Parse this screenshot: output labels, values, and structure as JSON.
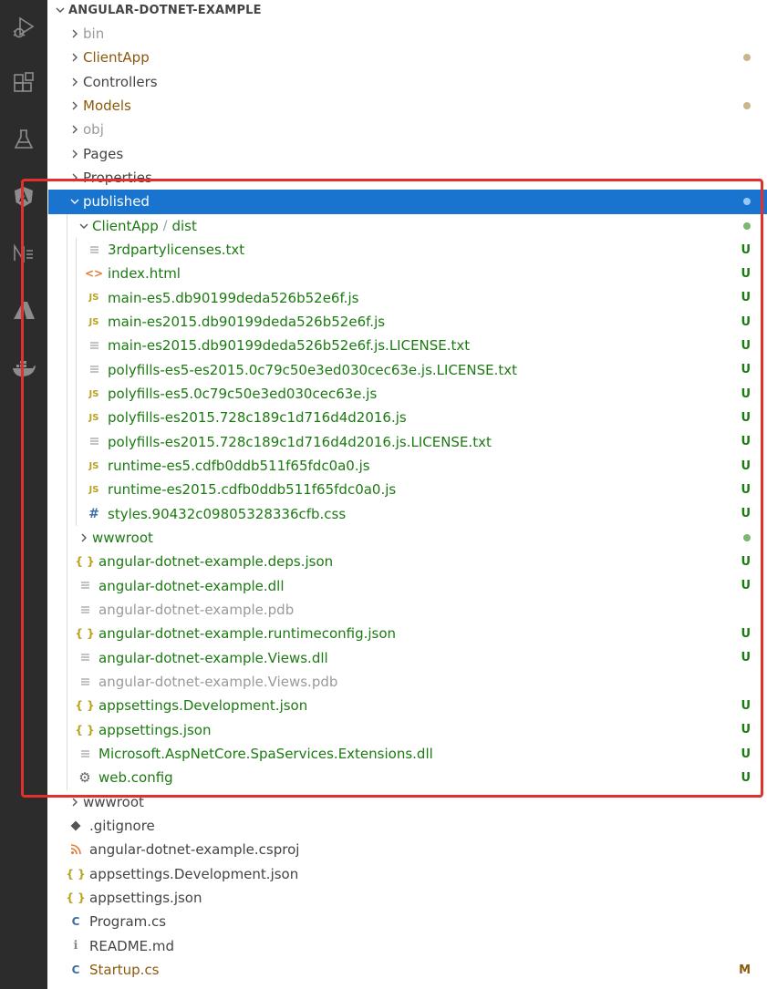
{
  "colors": {
    "activity_bar_bg": "#2c2c2c",
    "activity_icon": "#8c8c8c",
    "selected_bg": "#1874cf",
    "untracked_green": "#1c7a12",
    "modified_brown": "#8d5a0c",
    "ignored_gray": "#9a9a9a",
    "dot_tan": "#c9b68c",
    "dot_green": "#7ab86e",
    "dot_blue": "#9ac8f5",
    "highlight_red": "#e0322a",
    "js_icon": "#b9a21d",
    "json_icon": "#b9a21d",
    "html_icon": "#e37933",
    "css_icon": "#3c6fa8",
    "csproj_icon": "#e37933",
    "cs_icon": "#3c6fa8",
    "git_icon": "#555555"
  },
  "activity_bar": {
    "icons": [
      "run-debug-icon",
      "extensions-icon",
      "testing-icon",
      "angular-icon",
      "nuget-icon",
      "azure-icon",
      "docker-icon"
    ]
  },
  "explorer": {
    "root": {
      "label": "ANGULAR-DOTNET-EXAMPLE"
    },
    "items": [
      {
        "label": "bin",
        "kind": "folder",
        "depth": 1,
        "expanded": false,
        "color": "muted"
      },
      {
        "label": "ClientApp",
        "kind": "folder",
        "depth": 1,
        "expanded": false,
        "color": "mod",
        "badge": "dot-tan"
      },
      {
        "label": "Controllers",
        "kind": "folder",
        "depth": 1,
        "expanded": false,
        "color": "norm"
      },
      {
        "label": "Models",
        "kind": "folder",
        "depth": 1,
        "expanded": false,
        "color": "mod",
        "badge": "dot-tan"
      },
      {
        "label": "obj",
        "kind": "folder",
        "depth": 1,
        "expanded": false,
        "color": "muted"
      },
      {
        "label": "Pages",
        "kind": "folder",
        "depth": 1,
        "expanded": false,
        "color": "norm"
      },
      {
        "label": "Properties",
        "kind": "folder",
        "depth": 1,
        "expanded": false,
        "color": "norm"
      },
      {
        "label": "published",
        "kind": "folder",
        "depth": 1,
        "expanded": true,
        "color": "green",
        "badge": "dot-blue",
        "selected": true
      },
      {
        "label": "ClientApp",
        "label2": "dist",
        "kind": "folder",
        "depth": 2,
        "expanded": true,
        "color": "green",
        "badge": "dot-green"
      },
      {
        "label": "3rdpartylicenses.txt",
        "kind": "txt",
        "depth": 3,
        "color": "green",
        "badge": "U"
      },
      {
        "label": "index.html",
        "kind": "html",
        "depth": 3,
        "color": "green",
        "badge": "U"
      },
      {
        "label": "main-es5.db90199deda526b52e6f.js",
        "kind": "js",
        "depth": 3,
        "color": "green",
        "badge": "U"
      },
      {
        "label": "main-es2015.db90199deda526b52e6f.js",
        "kind": "js",
        "depth": 3,
        "color": "green",
        "badge": "U"
      },
      {
        "label": "main-es2015.db90199deda526b52e6f.js.LICENSE.txt",
        "kind": "txt",
        "depth": 3,
        "color": "green",
        "badge": "U"
      },
      {
        "label": "polyfills-es5-es2015.0c79c50e3ed030cec63e.js.LICENSE.txt",
        "kind": "txt",
        "depth": 3,
        "color": "green",
        "badge": "U"
      },
      {
        "label": "polyfills-es5.0c79c50e3ed030cec63e.js",
        "kind": "js",
        "depth": 3,
        "color": "green",
        "badge": "U"
      },
      {
        "label": "polyfills-es2015.728c189c1d716d4d2016.js",
        "kind": "js",
        "depth": 3,
        "color": "green",
        "badge": "U"
      },
      {
        "label": "polyfills-es2015.728c189c1d716d4d2016.js.LICENSE.txt",
        "kind": "txt",
        "depth": 3,
        "color": "green",
        "badge": "U"
      },
      {
        "label": "runtime-es5.cdfb0ddb511f65fdc0a0.js",
        "kind": "js",
        "depth": 3,
        "color": "green",
        "badge": "U"
      },
      {
        "label": "runtime-es2015.cdfb0ddb511f65fdc0a0.js",
        "kind": "js",
        "depth": 3,
        "color": "green",
        "badge": "U"
      },
      {
        "label": "styles.90432c09805328336cfb.css",
        "kind": "css",
        "depth": 3,
        "color": "green",
        "badge": "U"
      },
      {
        "label": "wwwroot",
        "kind": "folder",
        "depth": 2,
        "expanded": false,
        "color": "green",
        "badge": "dot-green"
      },
      {
        "label": "angular-dotnet-example.deps.json",
        "kind": "json",
        "depth": 2,
        "color": "green",
        "badge": "U"
      },
      {
        "label": "angular-dotnet-example.dll",
        "kind": "txt",
        "depth": 2,
        "color": "green",
        "badge": "U"
      },
      {
        "label": "angular-dotnet-example.pdb",
        "kind": "txt",
        "depth": 2,
        "color": "muted"
      },
      {
        "label": "angular-dotnet-example.runtimeconfig.json",
        "kind": "json",
        "depth": 2,
        "color": "green",
        "badge": "U"
      },
      {
        "label": "angular-dotnet-example.Views.dll",
        "kind": "txt",
        "depth": 2,
        "color": "green",
        "badge": "U"
      },
      {
        "label": "angular-dotnet-example.Views.pdb",
        "kind": "txt",
        "depth": 2,
        "color": "muted"
      },
      {
        "label": "appsettings.Development.json",
        "kind": "json",
        "depth": 2,
        "color": "green",
        "badge": "U"
      },
      {
        "label": "appsettings.json",
        "kind": "json",
        "depth": 2,
        "color": "green",
        "badge": "U"
      },
      {
        "label": "Microsoft.AspNetCore.SpaServices.Extensions.dll",
        "kind": "txt",
        "depth": 2,
        "color": "green",
        "badge": "U"
      },
      {
        "label": "web.config",
        "kind": "config",
        "depth": 2,
        "color": "green",
        "badge": "U"
      },
      {
        "label": "wwwroot",
        "kind": "folder",
        "depth": 1,
        "expanded": false,
        "color": "norm"
      },
      {
        "label": ".gitignore",
        "kind": "git",
        "depth": 1,
        "color": "norm"
      },
      {
        "label": "angular-dotnet-example.csproj",
        "kind": "csproj",
        "depth": 1,
        "color": "norm"
      },
      {
        "label": "appsettings.Development.json",
        "kind": "json",
        "depth": 1,
        "color": "norm"
      },
      {
        "label": "appsettings.json",
        "kind": "json",
        "depth": 1,
        "color": "norm"
      },
      {
        "label": "Program.cs",
        "kind": "cs",
        "depth": 1,
        "color": "norm"
      },
      {
        "label": "README.md",
        "kind": "md",
        "depth": 1,
        "color": "norm"
      },
      {
        "label": "Startup.cs",
        "kind": "cs",
        "depth": 1,
        "color": "mod",
        "badge": "M"
      }
    ]
  }
}
